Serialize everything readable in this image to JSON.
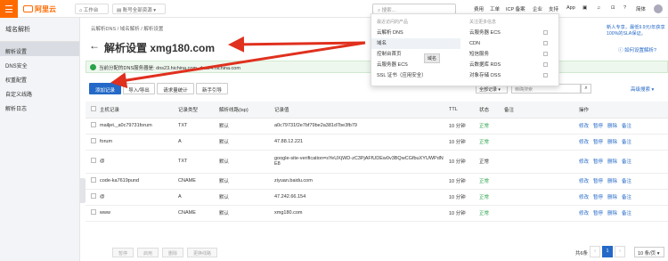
{
  "topbar": {
    "logo_text": "阿里云",
    "workbench": "工作台",
    "account_switch": "账号全部资源",
    "search_placeholder": "搜索...",
    "nav": [
      "费用",
      "工单",
      "ICP 备案",
      "企业",
      "支持",
      "App"
    ],
    "lang": "简体"
  },
  "sidebar": {
    "title": "域名解析",
    "items": [
      "解析设置",
      "DNS安全",
      "权重配置",
      "自定义线路",
      "解析日志"
    ]
  },
  "breadcrumb": [
    "云解析DNS",
    "域名解析",
    "解析设置"
  ],
  "page": {
    "title": "解析设置 xmg180.com",
    "help": "如何设置解析?",
    "notice": "新人专享，最低9.9元/年获享100%的SLA保证。",
    "dns_info": "当前分配的DNS服务器是: dns23.hichina.com, dns24.hichina.com"
  },
  "toolbar": {
    "add_record": "添加记录",
    "import_export": "导入/导出",
    "stats": "请求量统计",
    "guide": "新手引导",
    "type_select": "全部记录",
    "keyword_placeholder": "精确搜索",
    "advanced": "高级搜索"
  },
  "table": {
    "headers": [
      "主机记录",
      "记录类型",
      "解析线路(isp)",
      "记录值",
      "TTL",
      "状态",
      "备注",
      "操作"
    ],
    "rows": [
      {
        "host": "mailjet._a0c79731forum",
        "type": "TXT",
        "line": "默认",
        "value": "a0c79731f2e7bf79be2a381d7be3fb79",
        "ttl": "10 分钟",
        "status": "正常"
      },
      {
        "host": "forum",
        "type": "A",
        "line": "默认",
        "value": "47.88.12.221",
        "ttl": "10 分钟",
        "status": "正常"
      },
      {
        "host": "@",
        "type": "TXT",
        "line": "默认",
        "value": "google-site-verification=sYeUXjWD-zC3PjAFfUDEw0v3BQwCGfbuXYUWPdNE8",
        "ttl": "10 分钟",
        "status": "正常"
      },
      {
        "host": "code-ka7619pund",
        "type": "CNAME",
        "line": "默认",
        "value": "ziyuan.baidu.com",
        "ttl": "10 分钟",
        "status": "正常"
      },
      {
        "host": "@",
        "type": "A",
        "line": "默认",
        "value": "47.242.66.154",
        "ttl": "10 分钟",
        "status": "正常"
      },
      {
        "host": "www",
        "type": "CNAME",
        "line": "默认",
        "value": "xmg180.com",
        "ttl": "10 分钟",
        "status": "正常"
      }
    ],
    "ops": [
      "修改",
      "暂停",
      "删除",
      "备注"
    ]
  },
  "bottom": {
    "buttons": [
      "暂停",
      "启用",
      "删除",
      "更换线路"
    ],
    "total": "共6条",
    "page": "1",
    "page_size": "10 条/页"
  },
  "dropdown": {
    "recent_head": "最近访问的产品",
    "follow_head": "关注更多信息",
    "recent": [
      "云解析 DNS",
      "域名",
      "控制台首页",
      "云服务器 ECS",
      "SSL 证书（应用安全）"
    ],
    "follow": [
      "云服务器 ECS",
      "CDN",
      "短信服务",
      "云数据库 RDS",
      "对象存储 OSS"
    ],
    "tooltip": "域名"
  },
  "colors": {
    "accent": "#ff6a00",
    "link": "#2469c7",
    "success": "#2aa34a",
    "arrow": "#e0301e"
  }
}
